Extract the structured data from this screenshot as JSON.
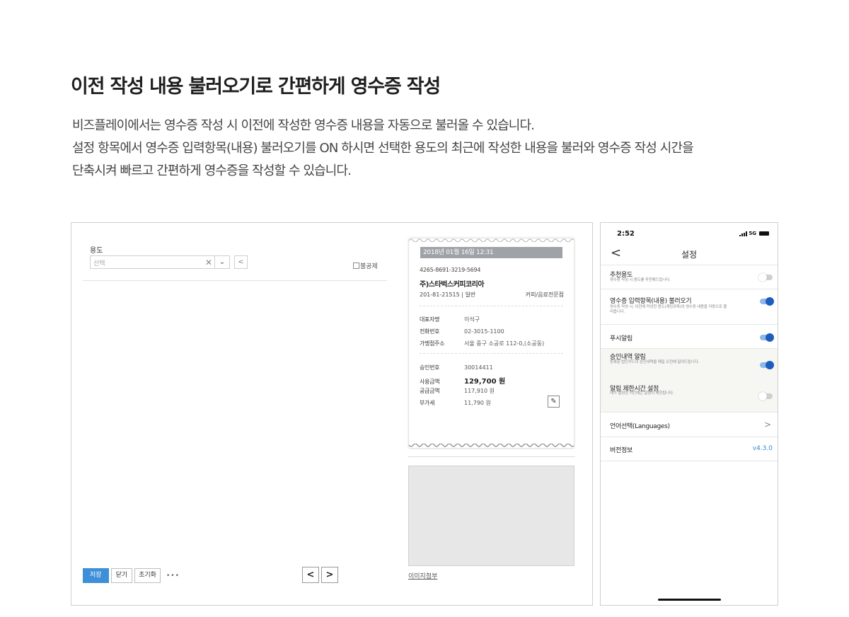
{
  "headline": "이전 작성 내용 불러오기로 간편하게 영수증 작성",
  "description": {
    "line1": "비즈플레이에서는 영수증 작성 시 이전에 작성한 영수증 내용을 자동으로 불러올 수 있습니다.",
    "line2": "설정 항목에서 영수증 입력항목(내용) 불러오기를 ON 하시면 선택한 용도의 최근에 작성한 내용을 불러와 영수증 작성 시간을",
    "line3": "단축시켜 빠르고 간편하게 영수증을 작성할 수 있습니다."
  },
  "desktop": {
    "usage_label": "용도",
    "usage_placeholder": "선택",
    "clear_glyph": "✕",
    "caret_glyph": "⌄",
    "share_glyph": "<",
    "nondeductible_label": "불공제",
    "buttons": {
      "save": "저장",
      "close": "닫기",
      "reset": "초기화",
      "more": "•••"
    },
    "pager": {
      "prev": "<",
      "next": ">"
    },
    "image_attach_link": "이미지첨부"
  },
  "receipt": {
    "datetime": "2018년 01월 16일 12:31",
    "card_number": "4265-8691-3219-5694",
    "store_name": "주)스타벅스커피코리아",
    "biz_number": "201-81-21515 | 일반",
    "category": "커피/음료전문점",
    "fields": [
      {
        "label": "대표자명",
        "value": "이석구"
      },
      {
        "label": "전화번호",
        "value": "02-3015-1100"
      },
      {
        "label": "가맹점주소",
        "value": "서울 중구 소공로 112-0,(소공동)"
      }
    ],
    "amounts": [
      {
        "label": "승인번호",
        "value": "30014411"
      },
      {
        "label": "사용금액",
        "value": "129,700 원"
      },
      {
        "label": "공급금액",
        "value": "117,910 원"
      },
      {
        "label": "부가세",
        "value": "11,790 원"
      }
    ],
    "edit_glyph": "✎"
  },
  "phone": {
    "time": "2:52",
    "network": "5G",
    "back_glyph": "<",
    "title": "설정",
    "items": [
      {
        "title": "추천용도",
        "subtitle": "영수증 작성 시 용도를 추천해드립니다.",
        "toggle": "off"
      },
      {
        "title": "영수증 입력항목(내용) 불러오기",
        "subtitle": "영수증 작성 시, 이전에 작성한 용도(계정과목)의 영수증 내용을 자동으로 불러옵니다.",
        "toggle": "on"
      },
      {
        "title": "푸시알림",
        "subtitle": "",
        "toggle": "on"
      },
      {
        "title": "승인내역 알림",
        "subtitle": "등록된 법인카드의 승인내역을 매일 오전에 알려드립니다.",
        "toggle": "on"
      },
      {
        "title": "알림 제한시간 설정",
        "subtitle": "내가 설정한 시간에는 알림이 제한됩니다.",
        "toggle": "off"
      }
    ],
    "language_label": "언어선택(Languages)",
    "chevron_glyph": ">",
    "version_label": "버전정보",
    "version_value": "v4.3.0"
  },
  "colors": {
    "primary_button": "#3c8fd8",
    "toggle_on": "#1c5dbd",
    "version_link": "#3a84d4",
    "receipt_header": "#9fa3a8"
  }
}
